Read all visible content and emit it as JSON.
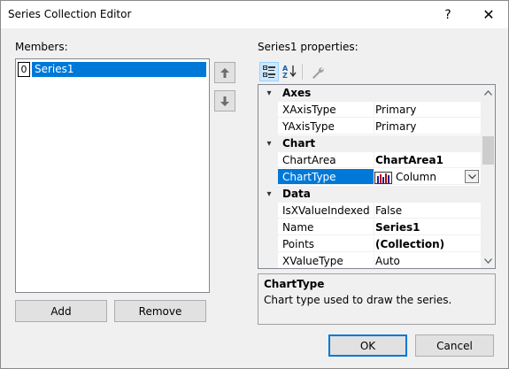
{
  "window": {
    "title": "Series Collection Editor",
    "help_glyph": "?",
    "close_glyph": "✕"
  },
  "members": {
    "label": "Members:",
    "items": [
      {
        "index": "0",
        "name": "Series1"
      }
    ],
    "add_label": "Add",
    "remove_label": "Remove"
  },
  "properties": {
    "label": "Series1 properties:",
    "categories": [
      {
        "name": "Axes",
        "rows": [
          {
            "name": "XAxisType",
            "value": "Primary"
          },
          {
            "name": "YAxisType",
            "value": "Primary"
          }
        ]
      },
      {
        "name": "Chart",
        "rows": [
          {
            "name": "ChartArea",
            "value": "ChartArea1"
          },
          {
            "name": "ChartType",
            "value": "Column"
          }
        ]
      },
      {
        "name": "Data",
        "rows": [
          {
            "name": "IsXValueIndexed",
            "value": "False"
          },
          {
            "name": "Name",
            "value": "Series1"
          },
          {
            "name": "Points",
            "value": "(Collection)"
          },
          {
            "name": "XValueType",
            "value": "Auto"
          }
        ]
      }
    ],
    "selected": "ChartType",
    "description": {
      "title": "ChartType",
      "text": "Chart type used to draw the series."
    }
  },
  "footer": {
    "ok_label": "OK",
    "cancel_label": "Cancel"
  },
  "colors": {
    "selection": "#0078d7",
    "dialog_bg": "#f0f0f0"
  }
}
